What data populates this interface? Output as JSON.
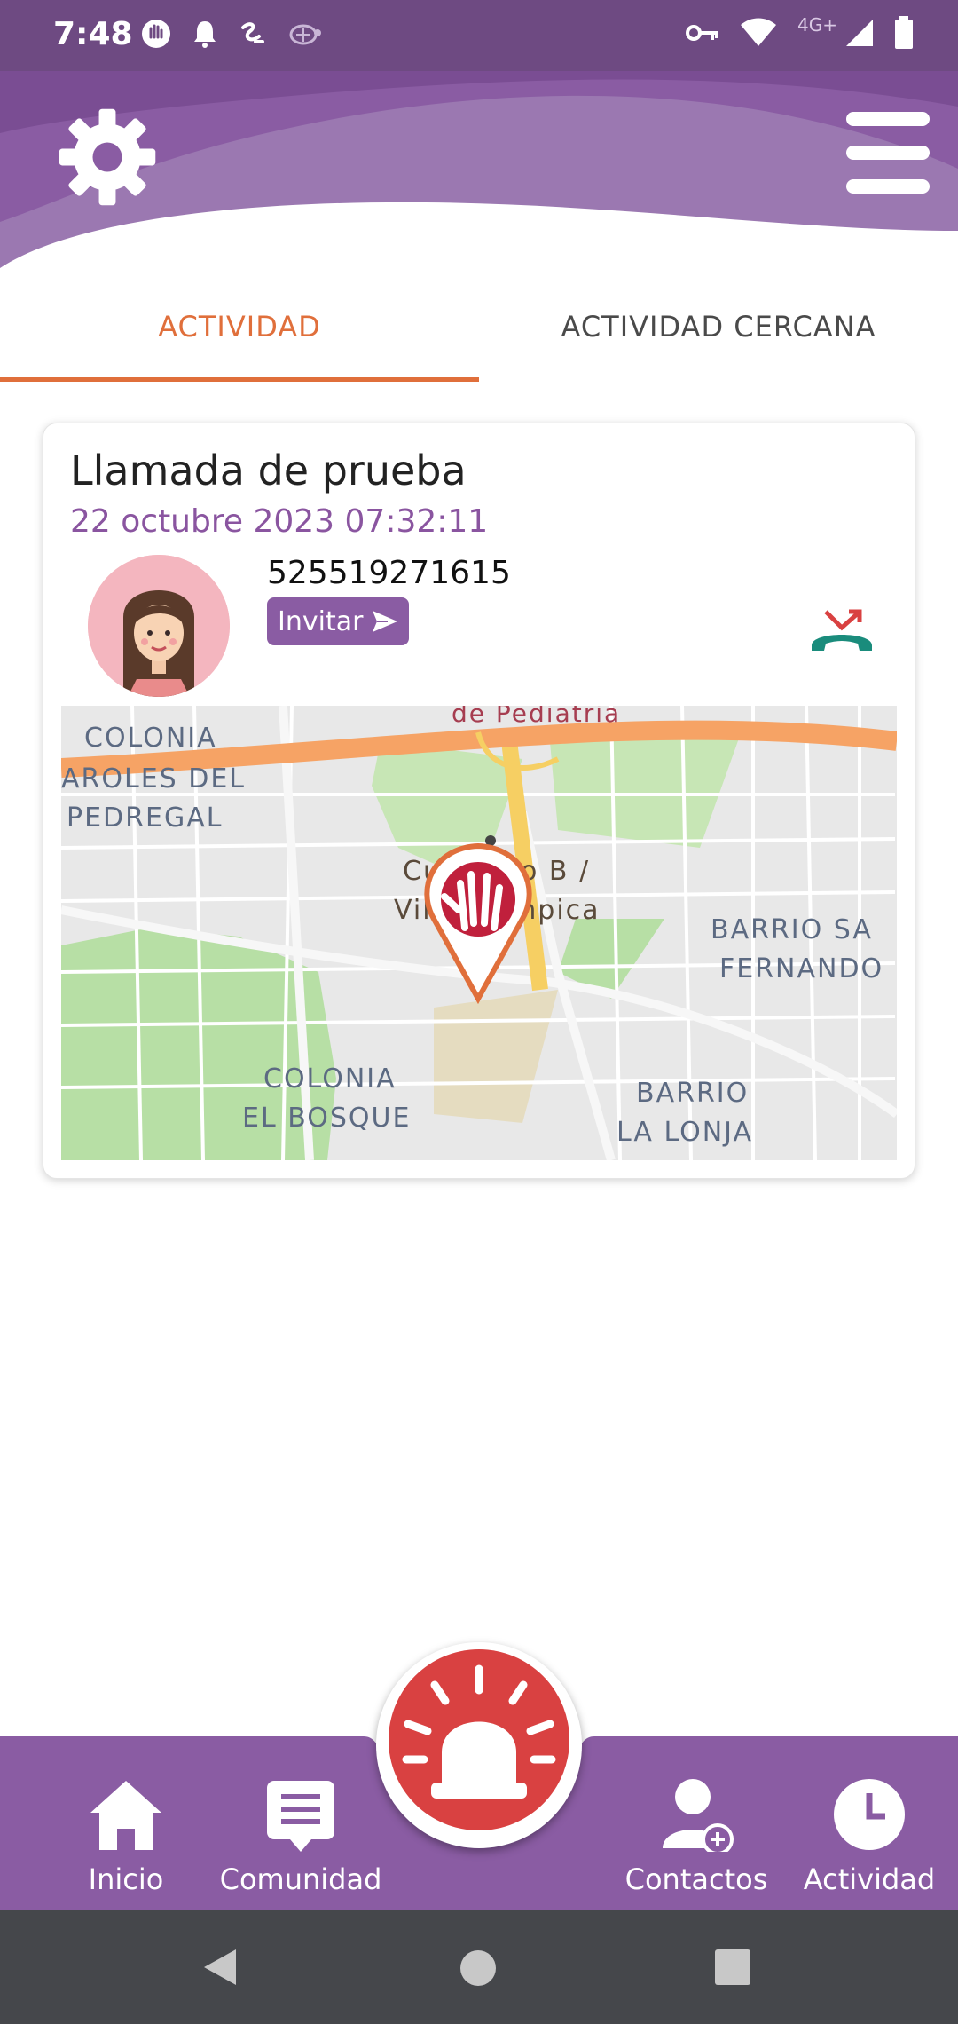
{
  "status_bar": {
    "time": "7:48",
    "network_label": "4G+",
    "icons": [
      "hand-app-icon",
      "bell-icon",
      "swirl-app-icon",
      "turtle-app-icon",
      "vpn-key-icon",
      "wifi-icon",
      "signal-icon",
      "battery-icon"
    ]
  },
  "header": {
    "settings_icon": "gear-icon",
    "menu_icon": "hamburger-menu-icon",
    "color": "#8a5ca3"
  },
  "tabs": [
    {
      "label": "ACTIVIDAD",
      "selected": true
    },
    {
      "label": "ACTIVIDAD CERCANA",
      "selected": false
    }
  ],
  "activity_card": {
    "title": "Llamada de prueba",
    "date": "22 octubre 2023 07:32:11",
    "phone": "525519271615",
    "invite_label": "Invitar",
    "call_status_icon": "missed-call-icon",
    "map": {
      "labels": {
        "pediatria": "de Pediatria",
        "colonia_line1": "COLONIA",
        "colonia_line2": "AROLES DEL",
        "colonia_line3": "PEDREGAL",
        "cuicuilco_line1": "Cuicuilco B /",
        "cuicuilco_line2": "Villa Olimpica",
        "barrio_line1": "BARRIO SA",
        "barrio_line2": "FERNANDO",
        "bosque_line1": "COLONIA",
        "bosque_line2": "EL BOSQUE",
        "lonja_line1": "BARRIO",
        "lonja_line2": "LA LONJA"
      }
    }
  },
  "bottom_nav": {
    "items": [
      {
        "label": "Inicio",
        "icon": "home-icon"
      },
      {
        "label": "Comunidad",
        "icon": "chat-icon"
      },
      {
        "label": "Contactos",
        "icon": "add-contact-icon"
      },
      {
        "label": "Actividad",
        "icon": "clock-icon"
      }
    ],
    "sos_icon": "alarm-siren-icon"
  },
  "colors": {
    "accent": "#e06f3b",
    "purple": "#8a5ca3",
    "sos_red": "#d94141"
  }
}
